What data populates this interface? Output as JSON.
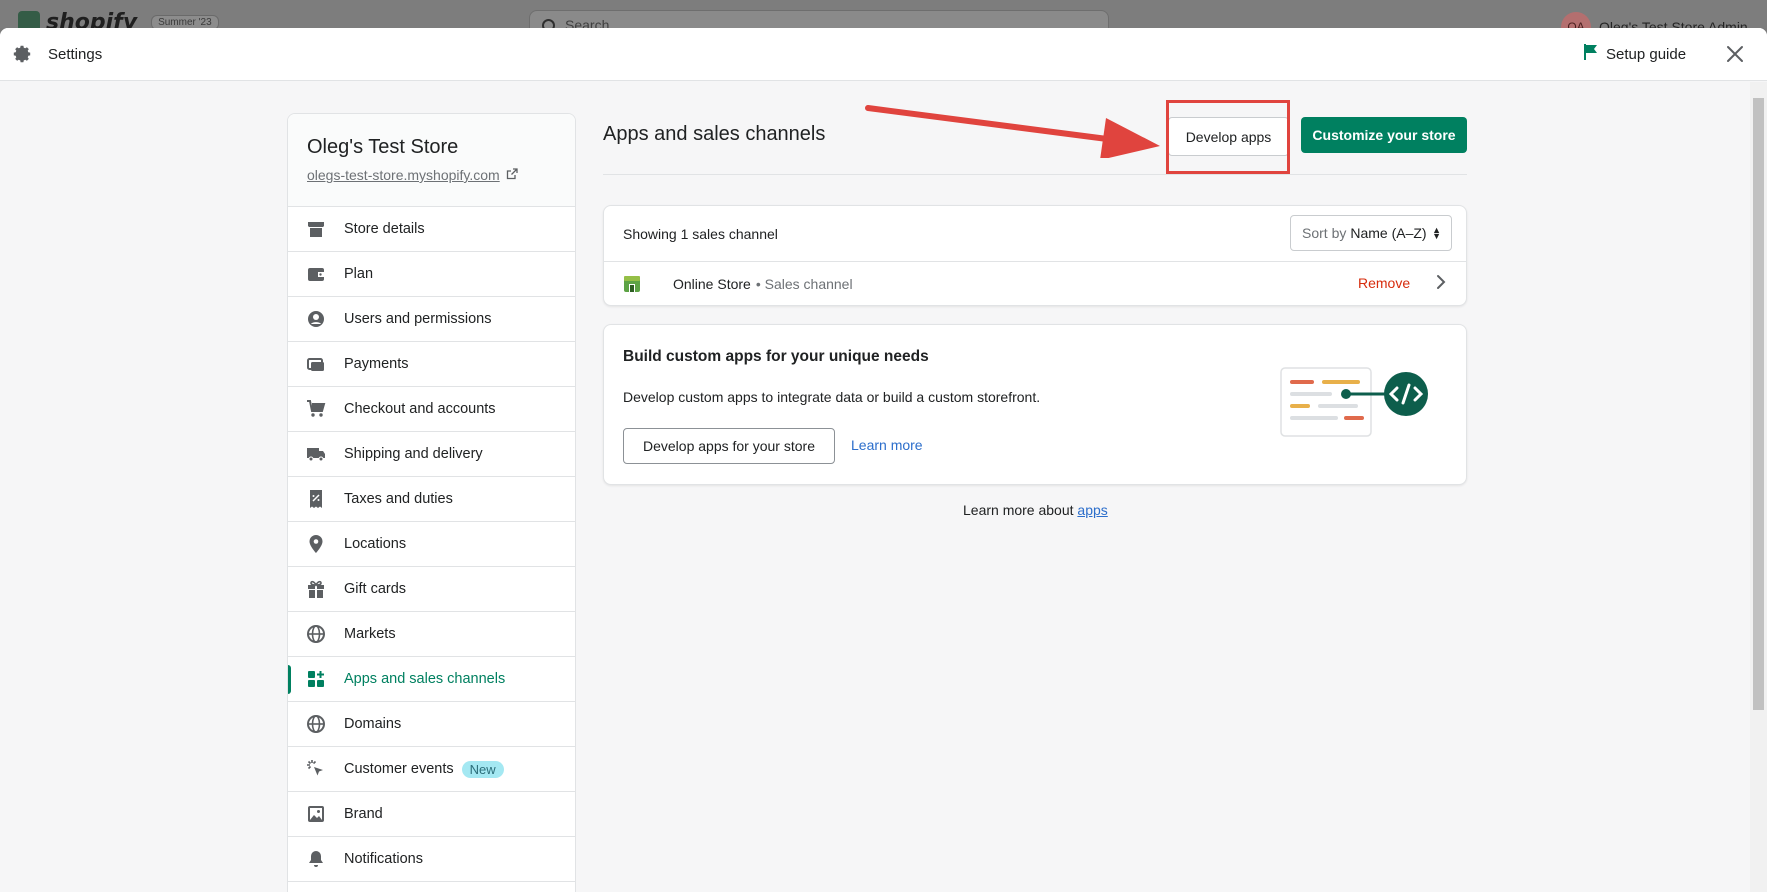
{
  "background": {
    "logo_text": "shopify",
    "badge": "Summer '23",
    "search_placeholder": "Search",
    "user_initials": "OA",
    "user_name": "Oleg's Test Store Admin"
  },
  "modal": {
    "title": "Settings",
    "setup_guide_label": "Setup guide"
  },
  "store": {
    "name": "Oleg's Test Store",
    "url": "olegs-test-store.myshopify.com"
  },
  "sidebar": {
    "items": [
      {
        "label": "Store details",
        "icon": "store-icon"
      },
      {
        "label": "Plan",
        "icon": "wallet-icon"
      },
      {
        "label": "Users and permissions",
        "icon": "user-icon"
      },
      {
        "label": "Payments",
        "icon": "credit-card-icon"
      },
      {
        "label": "Checkout and accounts",
        "icon": "cart-icon"
      },
      {
        "label": "Shipping and delivery",
        "icon": "truck-icon"
      },
      {
        "label": "Taxes and duties",
        "icon": "receipt-icon"
      },
      {
        "label": "Locations",
        "icon": "location-pin-icon"
      },
      {
        "label": "Gift cards",
        "icon": "gift-icon"
      },
      {
        "label": "Markets",
        "icon": "globe-icon"
      },
      {
        "label": "Apps and sales channels",
        "icon": "apps-icon",
        "active": true
      },
      {
        "label": "Domains",
        "icon": "globe-icon"
      },
      {
        "label": "Customer events",
        "icon": "cursor-click-icon",
        "badge": "New"
      },
      {
        "label": "Brand",
        "icon": "image-icon"
      },
      {
        "label": "Notifications",
        "icon": "bell-icon"
      }
    ]
  },
  "main": {
    "title": "Apps and sales channels",
    "develop_apps_label": "Develop apps",
    "customize_label": "Customize your store",
    "channels": {
      "showing_text": "Showing 1 sales channel",
      "sort_prefix": "Sort by",
      "sort_value": "Name (A–Z)",
      "rows": [
        {
          "name": "Online Store",
          "type": "• Sales channel",
          "remove_label": "Remove"
        }
      ]
    },
    "build": {
      "heading": "Build custom apps for your unique needs",
      "description": "Develop custom apps to integrate data or build a custom storefront.",
      "button_label": "Develop apps for your store",
      "learn_more_label": "Learn more"
    },
    "footer": {
      "prefix": "Learn more about",
      "link": "apps"
    }
  },
  "colors": {
    "primary_green": "#008060",
    "link_blue": "#2c6ecb",
    "critical_red": "#d72c0d",
    "annotation_red": "#e0443e"
  }
}
